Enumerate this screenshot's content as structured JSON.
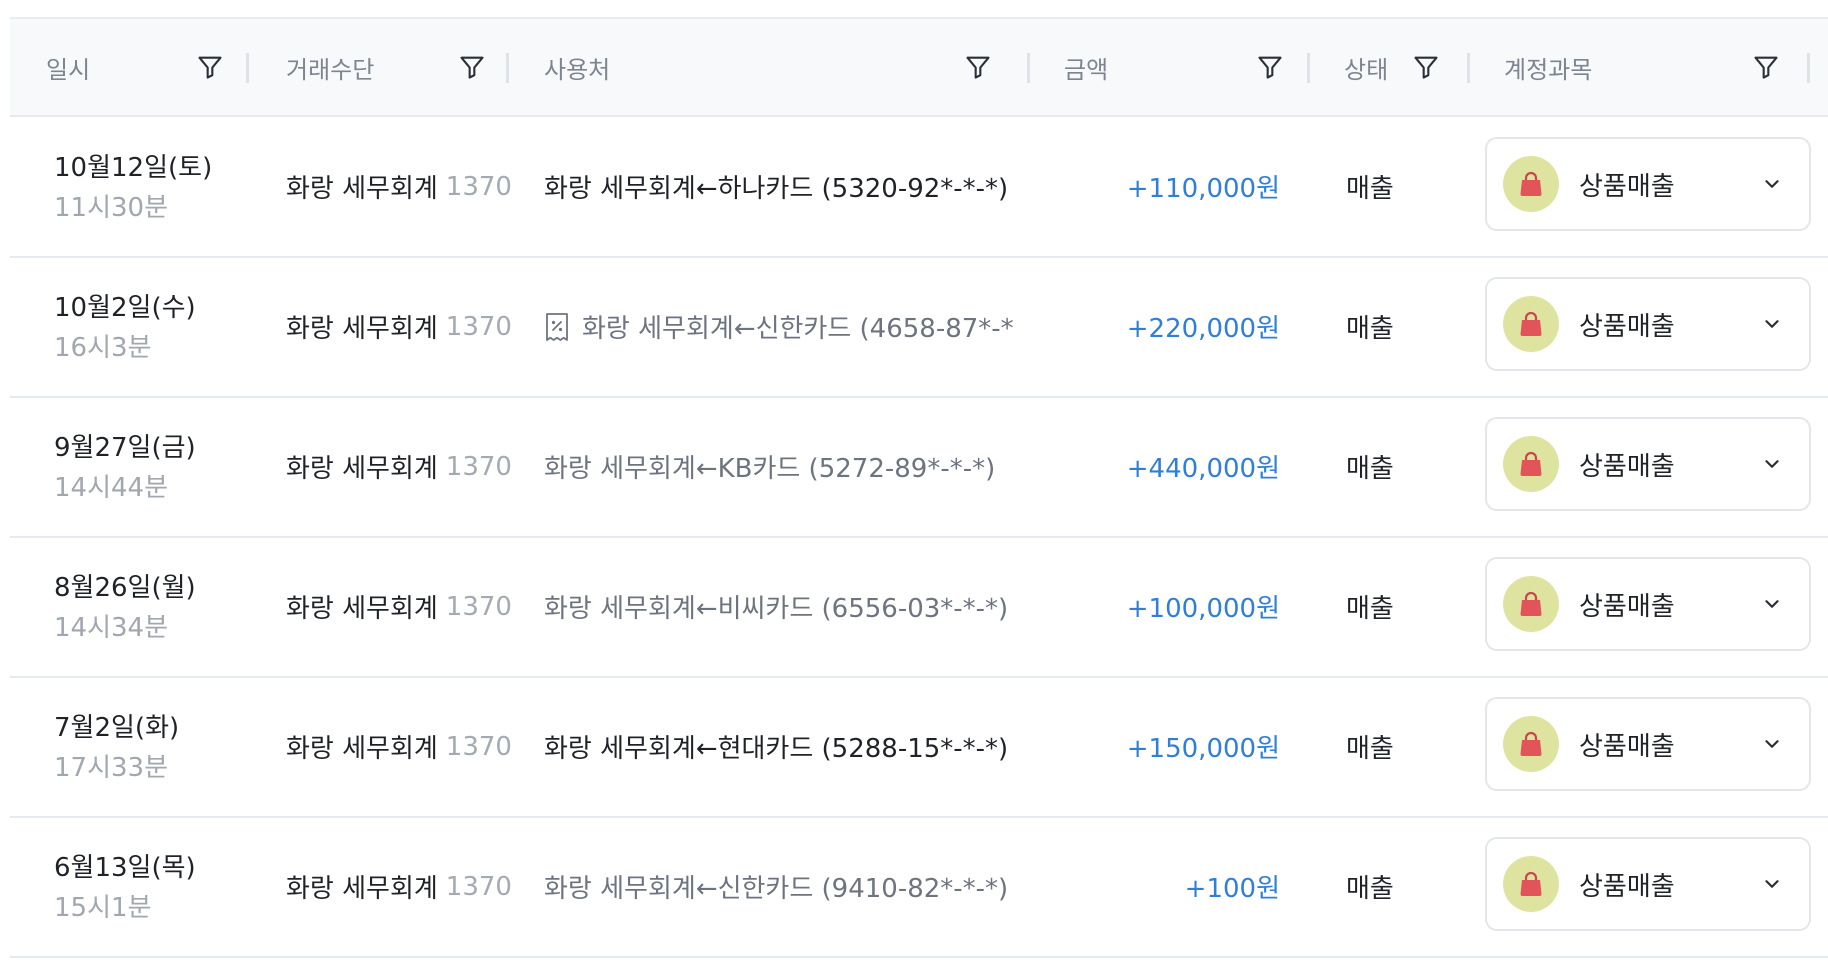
{
  "header": {
    "date": "일시",
    "method": "거래수단",
    "merchant": "사용처",
    "amount": "금액",
    "status": "상태",
    "account": "계정과목"
  },
  "icons": {
    "filter": "filter-icon",
    "receipt": "receipt-icon",
    "bag": "shopping-bag-icon",
    "chevron": "chevron-down-icon"
  },
  "colors": {
    "amount": "#2f7fd8",
    "bag": "#e0545a",
    "bag_bg": "#dfe3a0"
  },
  "rows": [
    {
      "date": "10월12일(토)",
      "time": "11시30분",
      "method_name": "화랑 세무회계",
      "method_num": "1370",
      "merchant": "화랑 세무회계←하나카드 (5320-92*-*-*)",
      "amount": "+110,000원",
      "status": "매출",
      "account": "상품매출"
    },
    {
      "date": "10월2일(수)",
      "time": "16시3분",
      "method_name": "화랑 세무회계",
      "method_num": "1370",
      "merchant": "화랑 세무회계←신한카드 (4658-87*-*",
      "amount": "+220,000원",
      "status": "매출",
      "account": "상품매출"
    },
    {
      "date": "9월27일(금)",
      "time": "14시44분",
      "method_name": "화랑 세무회계",
      "method_num": "1370",
      "merchant": "화랑 세무회계←KB카드 (5272-89*-*-*)",
      "amount": "+440,000원",
      "status": "매출",
      "account": "상품매출"
    },
    {
      "date": "8월26일(월)",
      "time": "14시34분",
      "method_name": "화랑 세무회계",
      "method_num": "1370",
      "merchant": "화랑 세무회계←비씨카드 (6556-03*-*-*)",
      "amount": "+100,000원",
      "status": "매출",
      "account": "상품매출"
    },
    {
      "date": "7월2일(화)",
      "time": "17시33분",
      "method_name": "화랑 세무회계",
      "method_num": "1370",
      "merchant": "화랑 세무회계←현대카드 (5288-15*-*-*)",
      "amount": "+150,000원",
      "status": "매출",
      "account": "상품매출"
    },
    {
      "date": "6월13일(목)",
      "time": "15시1분",
      "method_name": "화랑 세무회계",
      "method_num": "1370",
      "merchant": "화랑 세무회계←신한카드 (9410-82*-*-*)",
      "amount": "+100원",
      "status": "매출",
      "account": "상품매출"
    }
  ]
}
